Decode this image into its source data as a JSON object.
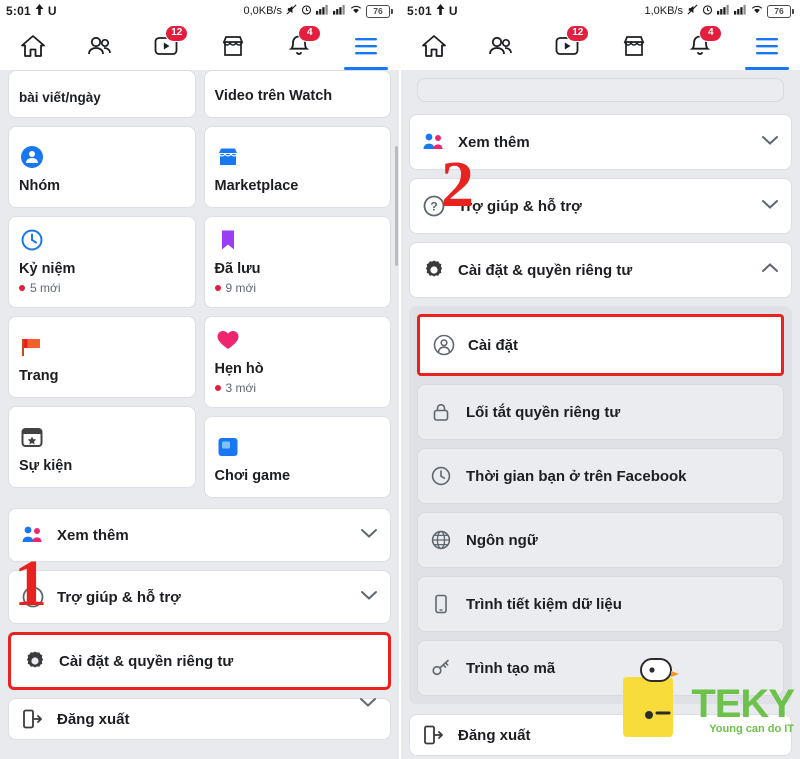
{
  "screens": [
    {
      "id": "left",
      "status_bar": {
        "time": "5:01",
        "icons_left": [
          "up-arrow-icon",
          "u-letter-icon"
        ],
        "net_speed": "0,0KB/s",
        "icons_right": [
          "mute-icon",
          "alarm-icon",
          "signal-icon",
          "signal-icon",
          "wifi-icon"
        ],
        "battery": "76"
      },
      "nav": {
        "tabs": [
          {
            "name": "home-tab",
            "icon": "home-icon",
            "badge": ""
          },
          {
            "name": "friends-tab",
            "icon": "friends-icon",
            "badge": ""
          },
          {
            "name": "watch-tab",
            "icon": "video-icon",
            "badge": "12"
          },
          {
            "name": "marketplace-tab",
            "icon": "store-icon",
            "badge": ""
          },
          {
            "name": "notifications-tab",
            "icon": "bell-icon",
            "badge": "4"
          },
          {
            "name": "menu-tab",
            "icon": "hamburger-icon",
            "badge": "",
            "active": true
          }
        ]
      },
      "grid": {
        "left_col": [
          {
            "label": "bài viết/ngày",
            "icon": "",
            "clipped": true
          },
          {
            "label": "Nhóm",
            "icon": "groups-icon",
            "sub": ""
          },
          {
            "label": "Kỷ niệm",
            "icon": "clock-icon",
            "sub": "5 mới"
          },
          {
            "label": "Trang",
            "icon": "flag-icon",
            "sub": ""
          },
          {
            "label": "Sự kiện",
            "icon": "event-icon",
            "sub": ""
          }
        ],
        "right_col": [
          {
            "label": "Video trên Watch",
            "icon": "",
            "clipped": true
          },
          {
            "label": "Marketplace",
            "icon": "store-icon",
            "sub": ""
          },
          {
            "label": "Đã lưu",
            "icon": "bookmark-icon",
            "sub": "9 mới"
          },
          {
            "label": "Hẹn hò",
            "icon": "heart-icon",
            "sub": "3 mới"
          },
          {
            "label": "Chơi game",
            "icon": "game-icon",
            "sub": ""
          }
        ]
      },
      "rows": [
        {
          "label": "Xem thêm",
          "icon": "people-icon",
          "chevron": "chevron-down-icon",
          "highlight": false
        },
        {
          "label": "Trợ giúp & hỗ trợ",
          "icon": "help-icon",
          "chevron": "chevron-down-icon",
          "highlight": false
        },
        {
          "label": "Cài đặt & quyền riêng tư",
          "icon": "gear-icon",
          "chevron": "chevron-down-icon",
          "highlight": true
        },
        {
          "label": "Đăng xuất",
          "icon": "logout-icon",
          "chevron": "",
          "highlight": false
        }
      ],
      "step_number": "1"
    },
    {
      "id": "right",
      "status_bar": {
        "time": "5:01",
        "net_speed": "1,0KB/s",
        "battery": "76"
      },
      "nav": {
        "tabs": [
          {
            "name": "home-tab",
            "icon": "home-icon",
            "badge": ""
          },
          {
            "name": "friends-tab",
            "icon": "friends-icon",
            "badge": ""
          },
          {
            "name": "watch-tab",
            "icon": "video-icon",
            "badge": "12"
          },
          {
            "name": "marketplace-tab",
            "icon": "store-icon",
            "badge": ""
          },
          {
            "name": "notifications-tab",
            "icon": "bell-icon",
            "badge": "4"
          },
          {
            "name": "menu-tab",
            "icon": "hamburger-icon",
            "badge": "",
            "active": true
          }
        ]
      },
      "rows": [
        {
          "label": "Xem thêm",
          "icon": "people-icon",
          "chevron": "chevron-down-icon"
        },
        {
          "label": "Trợ giúp & hỗ trợ",
          "icon": "help-icon",
          "chevron": "chevron-down-icon"
        },
        {
          "label": "Cài đặt & quyền riêng tư",
          "icon": "gear-icon",
          "chevron": "chevron-up-icon"
        }
      ],
      "panel_items": [
        {
          "label": "Cài đặt",
          "icon": "user-settings-icon",
          "selected": true
        },
        {
          "label": "Lối tắt quyền riêng tư",
          "icon": "lock-icon",
          "selected": false
        },
        {
          "label": "Thời gian bạn ở trên Facebook",
          "icon": "clock-icon",
          "selected": false
        },
        {
          "label": "Ngôn ngữ",
          "icon": "globe-icon",
          "selected": false
        },
        {
          "label": "Trình tiết kiệm dữ liệu",
          "icon": "phone-icon",
          "selected": false
        },
        {
          "label": "Trình tạo mã",
          "icon": "key-icon",
          "selected": false
        }
      ],
      "bottom_row": {
        "label": "Đăng xuất",
        "icon": "logout-icon"
      },
      "step_number": "2"
    }
  ],
  "watermark": {
    "text": "TEKY",
    "tagline": "Young can do IT"
  },
  "colors": {
    "accent": "#1877f2",
    "badge": "#e41e3f",
    "highlight": "#e8231f",
    "background": "#e9eaed",
    "watermark": "#6cc24a"
  }
}
